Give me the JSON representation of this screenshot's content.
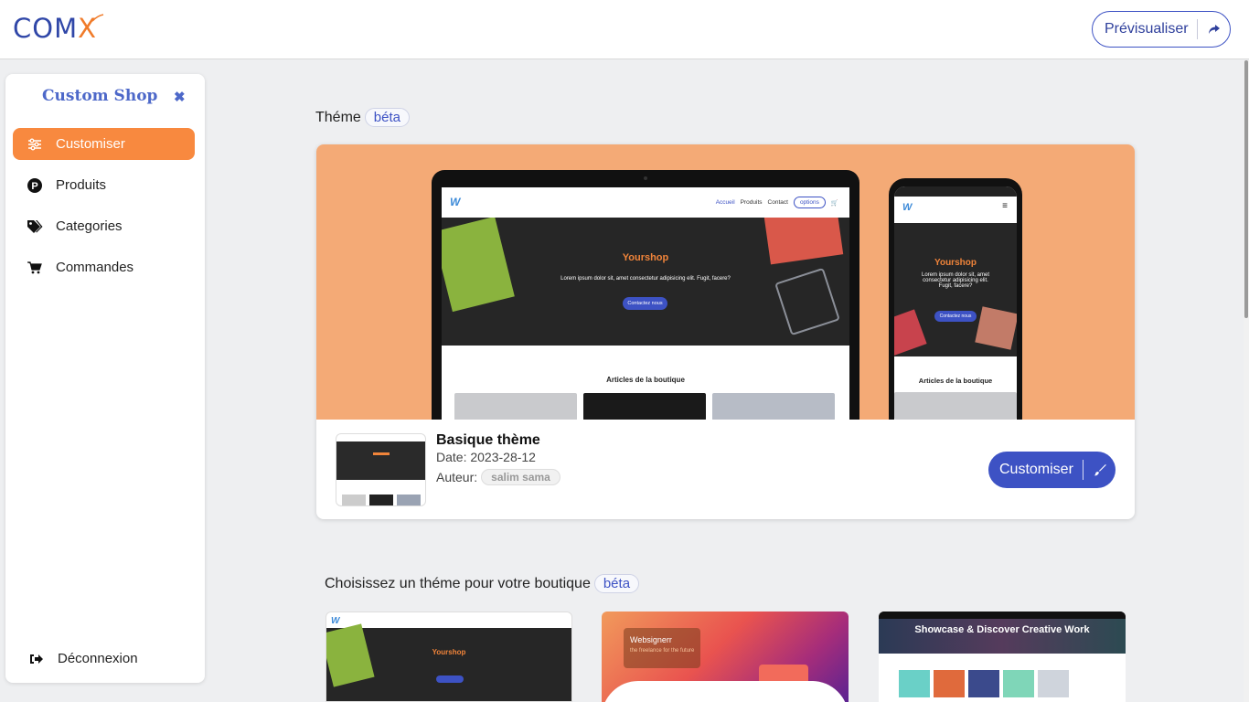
{
  "header": {
    "logo_text": "COM",
    "logo_accent": "X",
    "preview_label": "Prévisualiser"
  },
  "sidebar": {
    "title": "Custom Shop",
    "items": [
      {
        "label": "Customiser",
        "icon": "sliders-icon",
        "active": true
      },
      {
        "label": "Produits",
        "icon": "product-p-icon",
        "active": false
      },
      {
        "label": "Categories",
        "icon": "tags-icon",
        "active": false
      },
      {
        "label": "Commandes",
        "icon": "cart-icon",
        "active": false
      }
    ],
    "logout_label": "Déconnexion"
  },
  "current_theme": {
    "section_label": "Théme",
    "badge": "béta",
    "name": "Basique thème",
    "date": "Date: 2023-28-12",
    "author_label": "Auteur:",
    "author": "salim sama",
    "customise_label": "Customiser"
  },
  "mockup": {
    "nav_links": [
      "Accueil",
      "Produits",
      "Contact"
    ],
    "options_label": "options",
    "hero_title": "Yourshop",
    "hero_text": "Lorem ipsum dolor sit, amet consectetur adipisicing elit. Fugit, facere?",
    "hero_button": "Contactez nous",
    "articles_title": "Articles de la boutique"
  },
  "gallery": {
    "section_label": "Choisissez un théme pour votre boutique",
    "badge": "béta",
    "themes": [
      {
        "hero_title": "Yourshop"
      },
      {
        "title": "Websignerr",
        "subtitle": "the freelance for the future"
      },
      {
        "title": "Showcase & Discover Creative Work"
      }
    ]
  },
  "colors": {
    "brand": "#3d52c4",
    "accent": "#f8893f",
    "hero_bg": "#f4aa76"
  }
}
